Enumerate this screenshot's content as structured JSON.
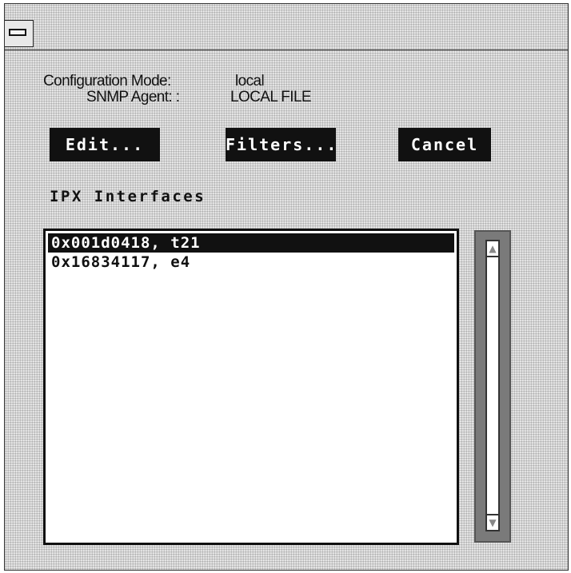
{
  "window": {
    "menu_icon": "window-menu-icon"
  },
  "config": {
    "mode_label": "Configuration Mode:",
    "mode_value": "local",
    "agent_label": "SNMP Agent: :",
    "agent_value": "LOCAL FILE"
  },
  "buttons": {
    "edit": "Edit...",
    "filters": "Filters...",
    "cancel": "Cancel"
  },
  "interfaces": {
    "title": "IPX Interfaces",
    "items": [
      "0x001d0418, t21",
      "0x16834117, e4"
    ],
    "selected_index": 0
  },
  "scrollbar": {
    "up_icon": "scroll-up-arrow-icon",
    "down_icon": "scroll-down-arrow-icon"
  },
  "colors": {
    "button_bg": "#111111",
    "button_text": "#ffffff",
    "selection_bg": "#111111",
    "scrollbar_bg": "#7a7a7a"
  }
}
